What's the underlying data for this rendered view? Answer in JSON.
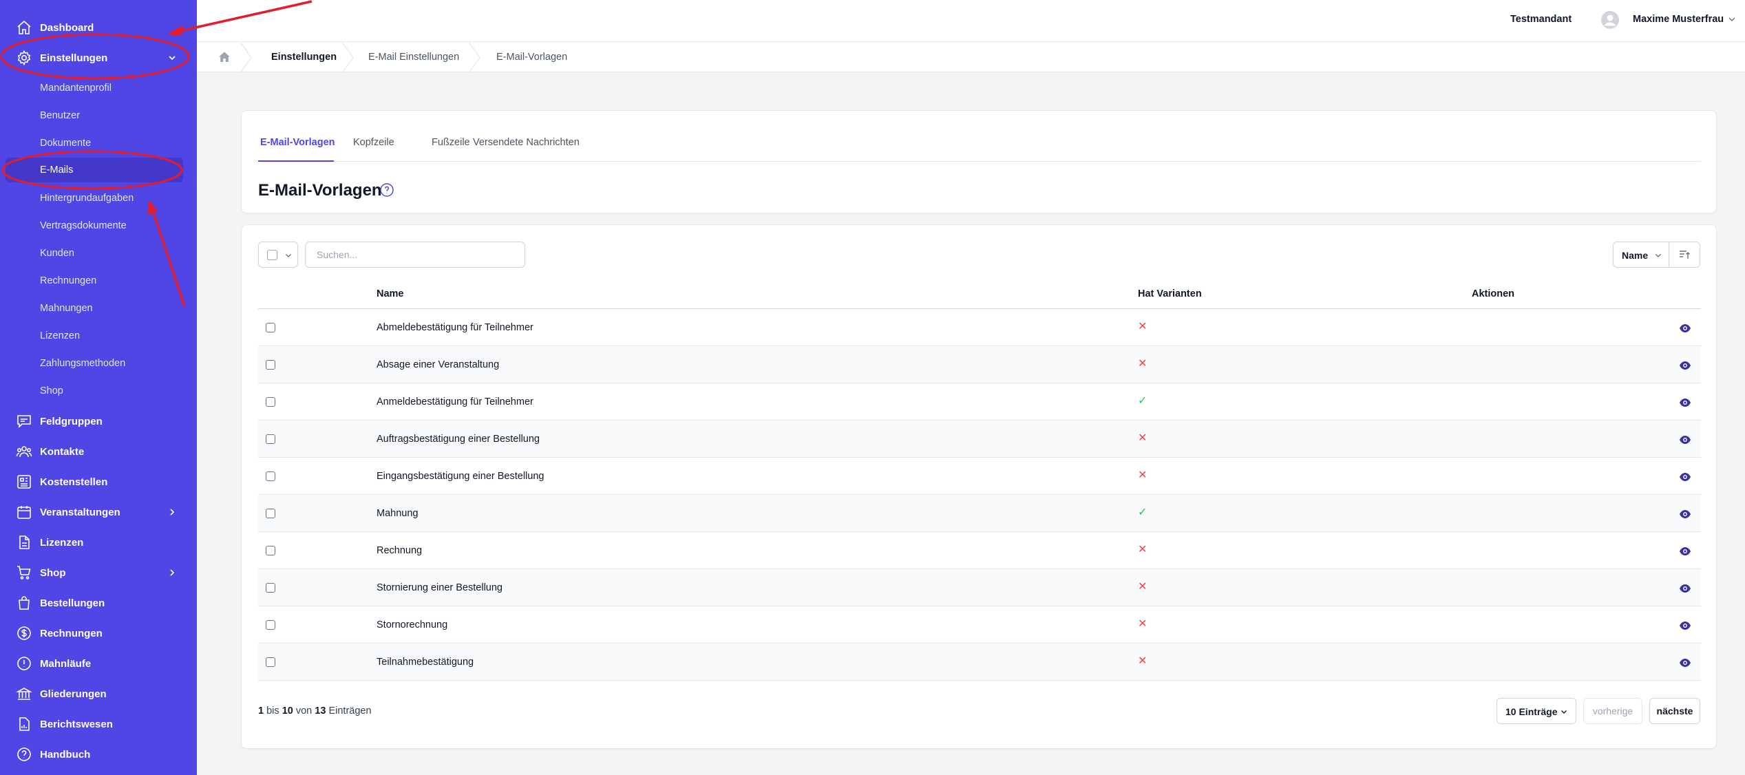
{
  "sidebar": {
    "items": [
      {
        "label": "Dashboard",
        "icon": "home-icon"
      },
      {
        "label": "Einstellungen",
        "icon": "gear-icon",
        "expanded": true
      },
      {
        "label": "Feldgruppen",
        "icon": "chat-icon"
      },
      {
        "label": "Kontakte",
        "icon": "users-icon"
      },
      {
        "label": "Kostenstellen",
        "icon": "building-icon"
      },
      {
        "label": "Veranstaltungen",
        "icon": "calendar-icon",
        "has_children": true
      },
      {
        "label": "Lizenzen",
        "icon": "document-icon"
      },
      {
        "label": "Shop",
        "icon": "cart-icon",
        "has_children": true
      },
      {
        "label": "Bestellungen",
        "icon": "bag-icon"
      },
      {
        "label": "Rechnungen",
        "icon": "dollar-icon"
      },
      {
        "label": "Mahnläufe",
        "icon": "alert-icon"
      },
      {
        "label": "Gliederungen",
        "icon": "bank-icon"
      },
      {
        "label": "Berichtswesen",
        "icon": "report-icon"
      },
      {
        "label": "Handbuch",
        "icon": "question-icon"
      }
    ],
    "submenu": [
      {
        "label": "Mandantenprofil"
      },
      {
        "label": "Benutzer"
      },
      {
        "label": "Dokumente"
      },
      {
        "label": "E-Mails",
        "active": true
      },
      {
        "label": "Hintergrundaufgaben"
      },
      {
        "label": "Vertragsdokumente"
      },
      {
        "label": "Kunden"
      },
      {
        "label": "Rechnungen"
      },
      {
        "label": "Mahnungen"
      },
      {
        "label": "Lizenzen"
      },
      {
        "label": "Zahlungsmethoden"
      },
      {
        "label": "Shop"
      }
    ]
  },
  "header": {
    "tenant": "Testmandant",
    "user": "Maxime Musterfrau"
  },
  "breadcrumb": [
    "Einstellungen",
    "E-Mail Einstellungen",
    "E-Mail-Vorlagen"
  ],
  "tabs": [
    {
      "label": "E-Mail-Vorlagen",
      "active": true
    },
    {
      "label": "Kopfzeile"
    },
    {
      "label": "Fußzeile"
    },
    {
      "label": "Versendete Nachrichten"
    }
  ],
  "page_title": "E-Mail-Vorlagen",
  "search": {
    "placeholder": "Suchen...",
    "value": ""
  },
  "sort": {
    "field": "Name"
  },
  "table": {
    "columns": [
      "Name",
      "Hat Varianten",
      "Aktionen"
    ],
    "rows": [
      {
        "name": "Abmeldebestätigung für Teilnehmer",
        "has_variants": false
      },
      {
        "name": "Absage einer Veranstaltung",
        "has_variants": false
      },
      {
        "name": "Anmeldebestätigung für Teilnehmer",
        "has_variants": true
      },
      {
        "name": "Auftragsbestätigung einer Bestellung",
        "has_variants": false
      },
      {
        "name": "Eingangsbestätigung einer Bestellung",
        "has_variants": false
      },
      {
        "name": "Mahnung",
        "has_variants": true
      },
      {
        "name": "Rechnung",
        "has_variants": false
      },
      {
        "name": "Stornierung einer Bestellung",
        "has_variants": false
      },
      {
        "name": "Stornorechnung",
        "has_variants": false
      },
      {
        "name": "Teilnahmebestätigung",
        "has_variants": false
      }
    ]
  },
  "pagination": {
    "from": "1",
    "word_to": "bis",
    "to": "10",
    "word_of": "von",
    "total": "13",
    "word_entries": "Einträgen",
    "page_size": "10 Einträge",
    "prev": "vorherige",
    "next": "nächste"
  },
  "colors": {
    "sidebar": "#4f46e5",
    "sidebar_active": "#4338ca",
    "accent": "#4f46e5",
    "no": "#ef4444",
    "yes": "#22c55e",
    "annotation": "#e11d2e"
  }
}
